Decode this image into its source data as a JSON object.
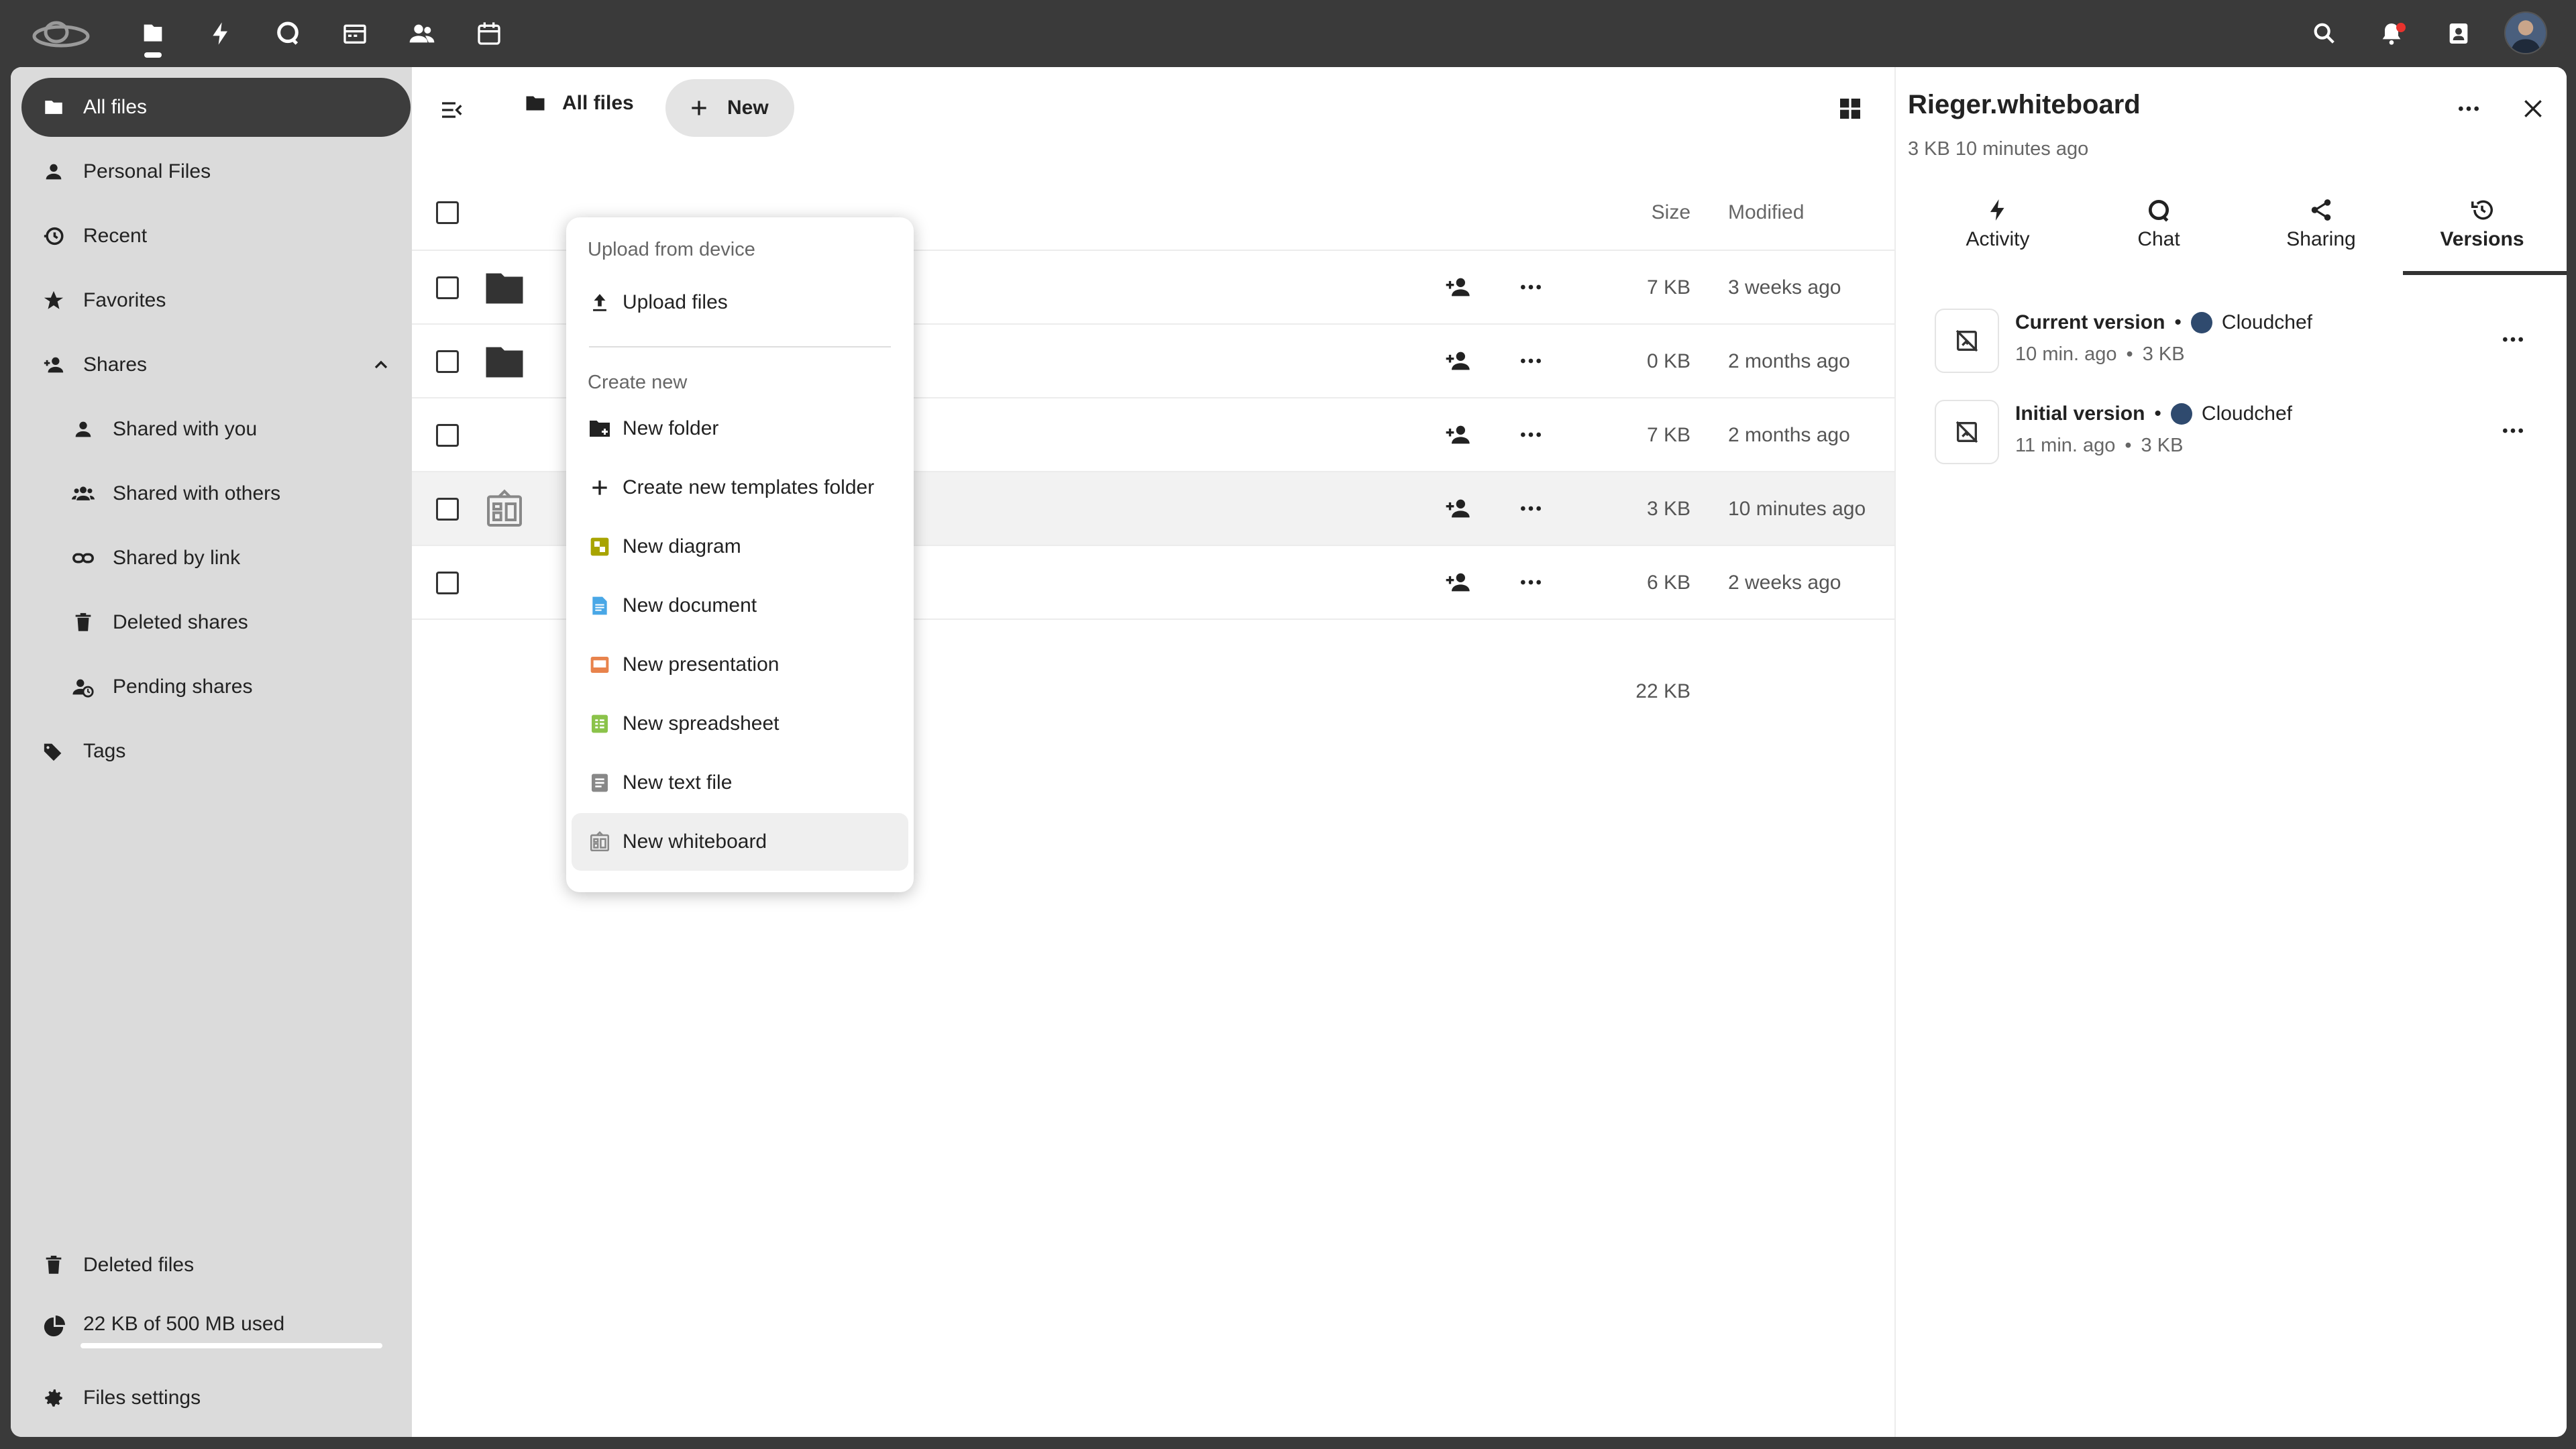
{
  "topbar": {
    "apps": [
      "logo-icon",
      "files-icon",
      "activity-icon",
      "talk-icon",
      "mail-icon",
      "contacts-icon",
      "calendar-icon"
    ],
    "right_icons": [
      "search-icon",
      "notifications-icon",
      "contacts-menu-icon",
      "user-avatar"
    ]
  },
  "nav": {
    "all_files": "All files",
    "personal": "Personal Files",
    "recent": "Recent",
    "favorites": "Favorites",
    "shares": "Shares",
    "shared_with_you": "Shared with you",
    "shared_with_others": "Shared with others",
    "shared_by_link": "Shared by link",
    "deleted_shares": "Deleted shares",
    "pending_shares": "Pending shares",
    "tags": "Tags",
    "deleted_files": "Deleted files",
    "quota": "22 KB of 500 MB used",
    "quota_fraction": 0.0,
    "settings": "Files settings"
  },
  "main": {
    "breadcrumb": "All files",
    "new_button": "New",
    "columns": {
      "size": "Size",
      "modified": "Modified"
    },
    "rows": [
      {
        "type": "folder",
        "size": "7 KB",
        "modified": "3 weeks ago"
      },
      {
        "type": "folder",
        "size": "0 KB",
        "modified": "2 months ago"
      },
      {
        "type": "file",
        "size": "7 KB",
        "modified": "2 months ago"
      },
      {
        "type": "whiteboard",
        "size": "3 KB",
        "modified": "10 minutes ago"
      },
      {
        "type": "file",
        "size": "6 KB",
        "modified": "2 weeks ago"
      }
    ],
    "total_size": "22 KB"
  },
  "menu": {
    "upload_caption": "Upload from device",
    "upload_files": "Upload files",
    "create_caption": "Create new",
    "items": [
      {
        "label": "New folder",
        "icon": "folder-plus-icon",
        "color": "#222222"
      },
      {
        "label": "Create new templates folder",
        "icon": "plus-icon",
        "color": "#222222"
      },
      {
        "label": "New diagram",
        "icon": "diagram-icon",
        "color": "#a8a400"
      },
      {
        "label": "New document",
        "icon": "document-icon",
        "color": "#49a7e6"
      },
      {
        "label": "New presentation",
        "icon": "presentation-icon",
        "color": "#e8834c"
      },
      {
        "label": "New spreadsheet",
        "icon": "spreadsheet-icon",
        "color": "#8bc34a"
      },
      {
        "label": "New text file",
        "icon": "text-file-icon",
        "color": "#888888"
      },
      {
        "label": "New whiteboard",
        "icon": "whiteboard-icon",
        "color": "#888888"
      }
    ]
  },
  "sidebar": {
    "title": "Rieger.whiteboard",
    "subtitle": "3 KB 10 minutes ago",
    "tabs": [
      "Activity",
      "Chat",
      "Sharing",
      "Versions"
    ],
    "active_tab": "Versions",
    "versions": [
      {
        "label": "Current version",
        "author": "Cloudchef",
        "time": "10 min. ago",
        "size": "3 KB"
      },
      {
        "label": "Initial version",
        "author": "Cloudchef",
        "time": "11 min. ago",
        "size": "3 KB"
      }
    ]
  }
}
